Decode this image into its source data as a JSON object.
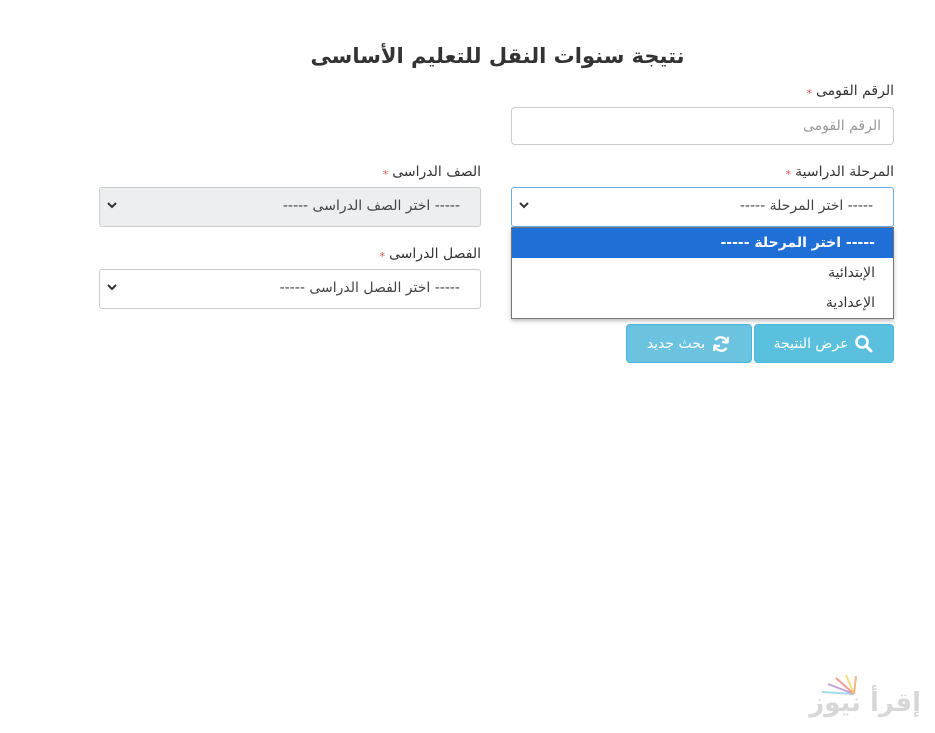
{
  "page": {
    "title": "نتيجة سنوات النقل للتعليم الأساسى"
  },
  "form": {
    "national_id": {
      "label": "الرقم القومى",
      "placeholder": "الرقم القومى",
      "required_mark": "*"
    },
    "stage": {
      "label": "المرحلة الدراسية",
      "required_mark": "*",
      "selected": "----- اختر المرحلة -----",
      "options": [
        "----- اختر المرحلة -----",
        "الإبتدائية",
        "الإعدادية"
      ],
      "expanded": true
    },
    "grade": {
      "label": "الصف الدراسى",
      "required_mark": "*",
      "selected": "----- اختر الصف الدراسى -----",
      "disabled": true
    },
    "term": {
      "label": "الفصل الدراسى",
      "required_mark": "*",
      "selected": "----- اختر الفصل الدراسى -----"
    }
  },
  "buttons": {
    "show_result": {
      "label": "عرض النتيجة",
      "icon": "search-icon"
    },
    "new_search": {
      "label": "بحث جديد",
      "icon": "refresh-icon"
    }
  },
  "watermark": {
    "text": "إقرأ نيوز"
  },
  "colors": {
    "button": "#5bc0de",
    "selected_option": "#1f6fd6",
    "required": "#d9534f",
    "disabled_field": "#eceeef"
  }
}
